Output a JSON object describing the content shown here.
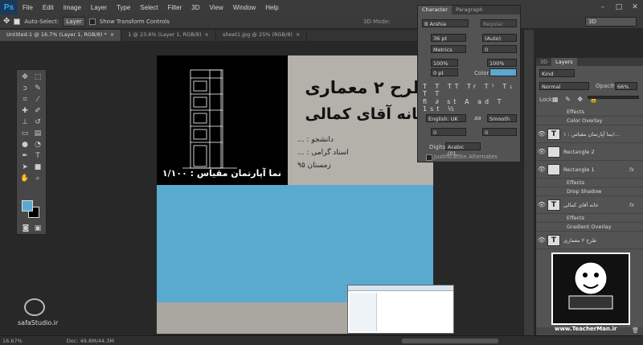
{
  "app": {
    "logo": "Ps"
  },
  "menu": [
    "File",
    "Edit",
    "Image",
    "Layer",
    "Type",
    "Select",
    "Filter",
    "3D",
    "View",
    "Window",
    "Help"
  ],
  "options": {
    "auto_select_label": "Auto-Select:",
    "auto_select_value": "Layer",
    "transform_label": "Show Transform Controls",
    "mode_label": "3D Mode:",
    "workspace": "3D"
  },
  "tabs": [
    {
      "label": "Untitled-1 @ 16.7% (Layer 1, RGB/8) *"
    },
    {
      "label": "1 @ 23.6% (Layer 1, RGB/8)"
    },
    {
      "label": "sheet1.jpg @ 25% (RGB/8)"
    }
  ],
  "canvas": {
    "title_lines": [
      "طرح ۲ معماری",
      "خانه آقای کمالی"
    ],
    "sub_lines": [
      "دانشجو : ...",
      "استاد گرامی : ...",
      "زمستان ۹۵"
    ],
    "facade_caption": "نما آپارتمان  مقیاس : ۱/۱۰۰",
    "accent": "#5aa9cf"
  },
  "character": {
    "tabs": [
      "Character",
      "Paragraph"
    ],
    "font": "B Arshia",
    "style": "Regular",
    "size": "36 pt",
    "leading": "(Auto)",
    "kerning": "Metrics",
    "tracking": "0",
    "vscale": "100%",
    "hscale": "100%",
    "baseline": "0 pt",
    "color_label": "Color:",
    "language": "English: UK",
    "aa": "aa",
    "smoothing": "Smooth",
    "val1": "0",
    "val2": "0",
    "digits_label": "Digits:",
    "digits": "Arabic (01...",
    "justification": "Justification Alternates"
  },
  "layers": {
    "tabs": [
      "3D",
      "Layers"
    ],
    "kind": "Kind",
    "blend": "Normal",
    "opacity_label": "Opacity:",
    "opacity": "66%",
    "lock_label": "Lock:",
    "fill_label": "Fill:",
    "rows": [
      {
        "type": "effect",
        "label": "Effects"
      },
      {
        "type": "effect",
        "label": "Color Overlay"
      },
      {
        "type": "layer",
        "thumb": "T",
        "label": "نما آپارتمان  مقیاس : ۱/..."
      },
      {
        "type": "layer",
        "thumb": "",
        "label": "Rectangle 2"
      },
      {
        "type": "layer",
        "thumb": "",
        "label": "Rectangle 1",
        "fx": "fx"
      },
      {
        "type": "effect",
        "label": "Effects"
      },
      {
        "type": "effect",
        "label": "Drop Shadow"
      },
      {
        "type": "layer",
        "thumb": "T",
        "label": "خانه آقای کمالی",
        "fx": "fx"
      },
      {
        "type": "effect",
        "label": "Effects"
      },
      {
        "type": "effect",
        "label": "Gradient Overlay"
      },
      {
        "type": "layer",
        "thumb": "T",
        "label": "طرح ۲ معماری"
      }
    ]
  },
  "watermark": {
    "brand": "safaStudio.ir",
    "teacher_site": "www.TeacherMan.ir"
  },
  "status": {
    "zoom": "16.67%",
    "doc": "Doc: 49.8M/44.3M"
  }
}
